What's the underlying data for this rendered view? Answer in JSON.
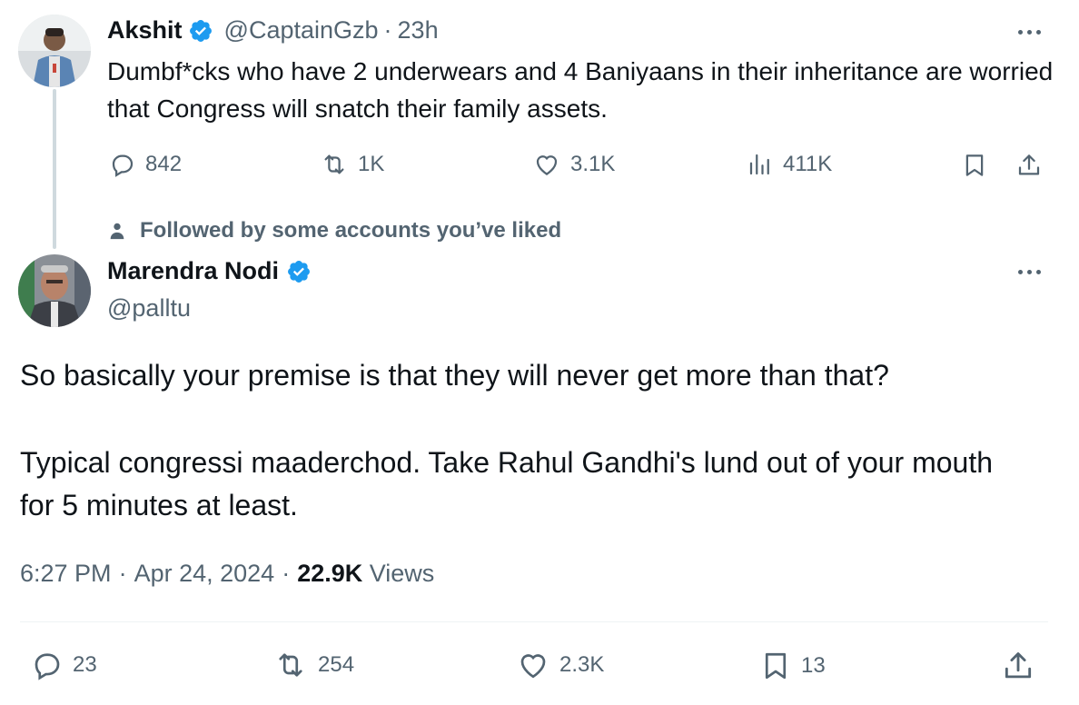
{
  "parent_tweet": {
    "name": "Akshit",
    "handle": "@CaptainGzb",
    "sep": "·",
    "time": "23h",
    "text": "Dumbf*cks who have 2 underwears and 4 Baniyaans in their inheritance are worried that Congress will snatch their family assets.",
    "replies": "842",
    "reposts": "1K",
    "likes": "3.1K",
    "views": "411K"
  },
  "social_context": "Followed by some accounts you’ve liked",
  "main_tweet": {
    "name": "Marendra Nodi",
    "handle": "@palltu",
    "paragraph1": "So basically your premise is that they will never get more than that?",
    "paragraph2": "Typical congressi maaderchod. Take Rahul Gandhi's lund out of your mouth for 5 minutes at least.",
    "time": "6:27 PM",
    "date": "Apr 24, 2024",
    "dot": "·",
    "views_count": "22.9K",
    "views_label": "Views",
    "replies": "23",
    "reposts": "254",
    "likes": "2.3K",
    "bookmarks": "13"
  },
  "colors": {
    "verified": "#1d9bf0",
    "secondary_text": "#536471",
    "primary_text": "#0f1419",
    "thread_line": "#cfd9de"
  },
  "icons": [
    "verified-badge-icon",
    "more-icon",
    "reply-icon",
    "repost-icon",
    "like-icon",
    "views-icon",
    "bookmark-icon",
    "share-icon",
    "person-icon"
  ]
}
